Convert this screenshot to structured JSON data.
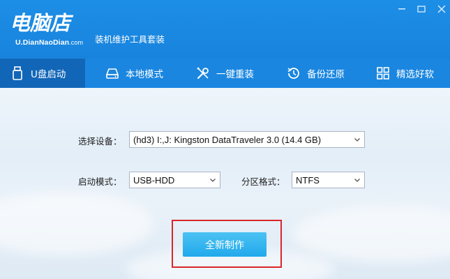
{
  "brand": {
    "name": "电脑店",
    "domain_prefix": "U.DianNaoDian",
    "domain_suffix": ".com",
    "suite_title": "装机维护工具套装"
  },
  "window_controls": [
    "minimize-icon",
    "maximize-icon",
    "close-icon"
  ],
  "nav": {
    "items": [
      {
        "label": "U盘启动",
        "icon": "usb-drive-icon",
        "active": true
      },
      {
        "label": "本地模式",
        "icon": "hard-disk-icon",
        "active": false
      },
      {
        "label": "一键重装",
        "icon": "tools-icon",
        "active": false
      },
      {
        "label": "备份还原",
        "icon": "history-icon",
        "active": false
      },
      {
        "label": "精选好软",
        "icon": "apps-grid-icon",
        "active": false
      }
    ]
  },
  "form": {
    "device_label": "选择设备：",
    "device_value": "(hd3) I:,J: Kingston DataTraveler 3.0 (14.4 GB)",
    "boot_mode_label": "启动模式：",
    "boot_mode_value": "USB-HDD",
    "partition_label": "分区格式：",
    "partition_value": "NTFS",
    "create_button": "全新制作"
  },
  "colors": {
    "title_bar": "#1d8ee6",
    "nav_bar": "#1a86e0",
    "nav_active": "#1266b8",
    "button": "#21a9ec",
    "highlight": "#d9262a"
  }
}
